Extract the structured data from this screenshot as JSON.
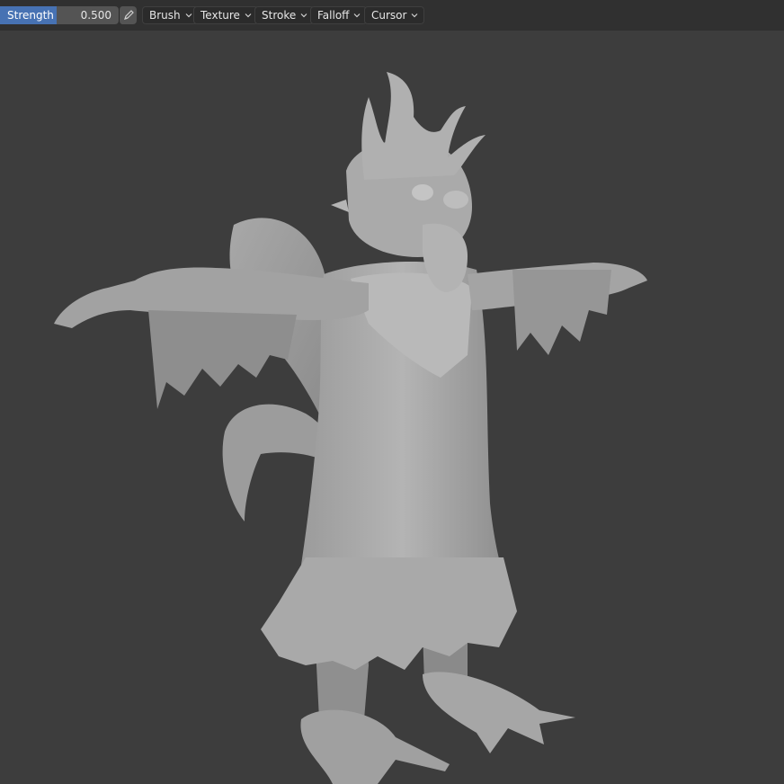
{
  "toolbar": {
    "strength": {
      "label": "Strength",
      "value": "0.500",
      "fill_fraction": 0.5
    },
    "pen_pressure_icon": "pen-pressure-icon",
    "menus": [
      {
        "label": "Brush"
      },
      {
        "label": "Texture"
      },
      {
        "label": "Stroke"
      },
      {
        "label": "Falloff"
      },
      {
        "label": "Cursor"
      }
    ]
  },
  "colors": {
    "header_bg": "#303030",
    "viewport_bg": "#3d3d3d",
    "slider_fill": "#4772b3",
    "slider_track": "#545454",
    "menu_bg": "#2b2b2b",
    "mesh": "#a4a4a4"
  }
}
